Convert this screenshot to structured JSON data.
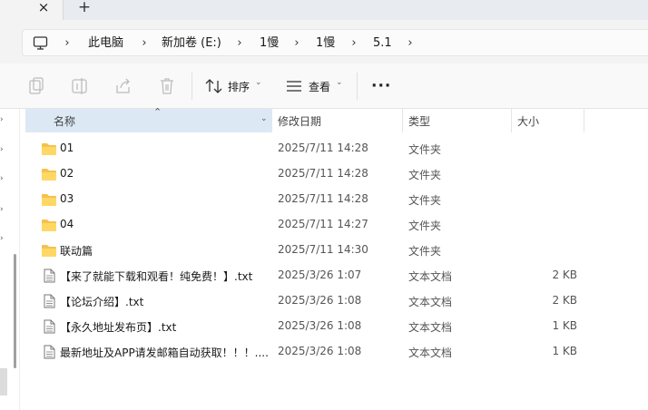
{
  "tabs": {
    "close_glyph": "×",
    "new_tab_glyph": "+"
  },
  "address": {
    "icon": "computer-icon",
    "separator": "›",
    "crumbs": [
      "此电脑",
      "新加卷 (E:)",
      "1慢",
      "1慢",
      "5.1"
    ]
  },
  "toolbar": {
    "sort_label": "排序",
    "view_label": "查看",
    "more_label": "···",
    "icons": [
      "copy-icon",
      "rename-icon",
      "share-icon",
      "delete-icon",
      "sort-icon",
      "view-icon",
      "more-icon"
    ]
  },
  "columns": {
    "name": "名称",
    "date": "修改日期",
    "type": "类型",
    "size": "大小"
  },
  "files": [
    {
      "icon": "folder-icon",
      "name": "01",
      "date": "2025/7/11 14:28",
      "type": "文件夹",
      "size": ""
    },
    {
      "icon": "folder-icon",
      "name": "02",
      "date": "2025/7/11 14:28",
      "type": "文件夹",
      "size": ""
    },
    {
      "icon": "folder-icon",
      "name": "03",
      "date": "2025/7/11 14:28",
      "type": "文件夹",
      "size": ""
    },
    {
      "icon": "folder-icon",
      "name": "04",
      "date": "2025/7/11 14:27",
      "type": "文件夹",
      "size": ""
    },
    {
      "icon": "folder-icon",
      "name": "联动篇",
      "date": "2025/7/11 14:30",
      "type": "文件夹",
      "size": ""
    },
    {
      "icon": "text-file-icon",
      "name": "【来了就能下载和观看！纯免费！】.txt",
      "date": "2025/3/26 1:07",
      "type": "文本文档",
      "size": "2 KB"
    },
    {
      "icon": "text-file-icon",
      "name": "【论坛介绍】.txt",
      "date": "2025/3/26 1:08",
      "type": "文本文档",
      "size": "2 KB"
    },
    {
      "icon": "text-file-icon",
      "name": "【永久地址发布页】.txt",
      "date": "2025/3/26 1:08",
      "type": "文本文档",
      "size": "1 KB"
    },
    {
      "icon": "text-file-icon",
      "name": "最新地址及APP请发邮箱自动获取！！！....",
      "date": "2025/3/26 1:08",
      "type": "文本文档",
      "size": "1 KB"
    }
  ],
  "colors": {
    "header_selected": "#dce9f5",
    "folder": "#f4c24f",
    "addr_bg": "#f3f3f3"
  }
}
